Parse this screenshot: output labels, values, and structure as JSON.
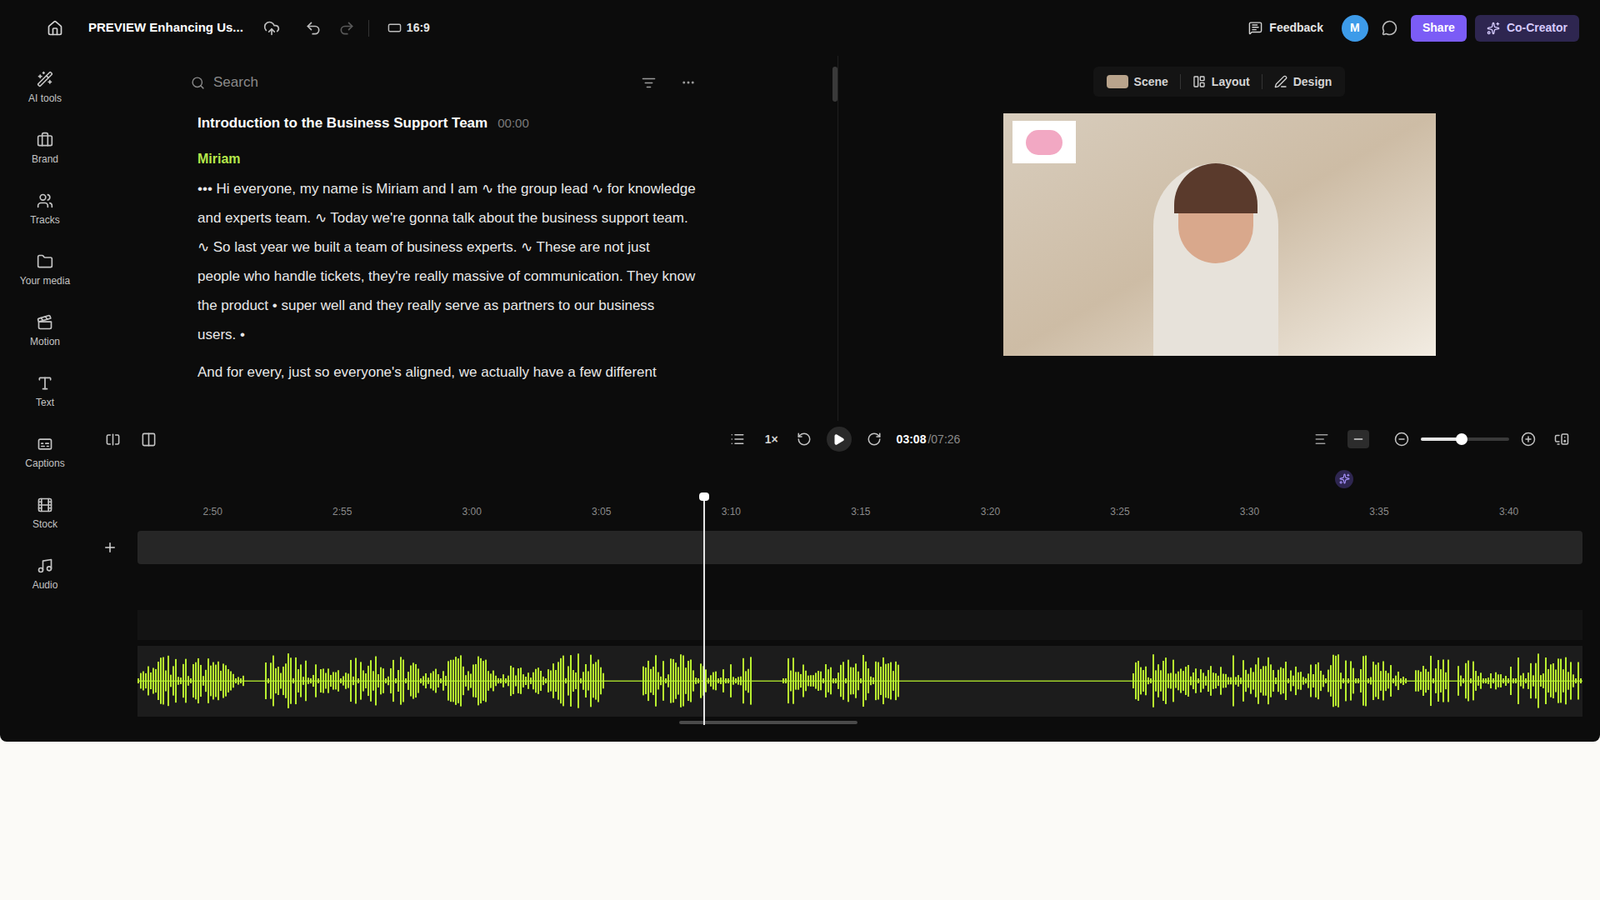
{
  "header": {
    "title": "PREVIEW Enhancing Us...",
    "aspect_ratio": "16:9",
    "feedback": "Feedback",
    "avatar": "M",
    "share": "Share",
    "co_creator": "Co-Creator"
  },
  "sidebar": {
    "items": [
      {
        "label": "AI tools",
        "selected": false
      },
      {
        "label": "Brand",
        "selected": false
      },
      {
        "label": "Tracks",
        "selected": false
      },
      {
        "label": "Your media",
        "selected": false
      },
      {
        "label": "Motion",
        "selected": false
      },
      {
        "label": "Text",
        "selected": false
      },
      {
        "label": "Captions",
        "selected": false
      },
      {
        "label": "Stock",
        "selected": false
      },
      {
        "label": "Audio",
        "selected": false
      }
    ]
  },
  "script": {
    "search_placeholder": "Search",
    "section_title": "Introduction to the Business Support Team",
    "section_time": "00:00",
    "speaker": "Miriam",
    "paragraphs": [
      "••• Hi everyone, my name is Miriam and I am ∿ the group lead ∿ for knowledge and experts team. ∿ Today we're gonna talk about the business support team. ∿ So last year we built a team of business experts. ∿ These are not just people who handle tickets, they're really massive of communication. They know the product • super well and they really serve as partners to our business users. •",
      "And for every, just so everyone's aligned, we actually have a few different"
    ]
  },
  "preview": {
    "tabs": [
      {
        "label": "Scene",
        "selected": false
      },
      {
        "label": "Layout",
        "selected": false
      },
      {
        "label": "Design",
        "selected": false
      }
    ]
  },
  "transport": {
    "speed": "1×",
    "current_time": "03:08",
    "total_time": "/07:26"
  },
  "zoom": {
    "level": 0.46
  },
  "timeline": {
    "ticks": [
      "2:50",
      "2:55",
      "3:00",
      "3:05",
      "3:10",
      "3:15",
      "3:20",
      "3:25",
      "3:30",
      "3:35",
      "3:40"
    ],
    "playhead_level": 0.392
  }
}
